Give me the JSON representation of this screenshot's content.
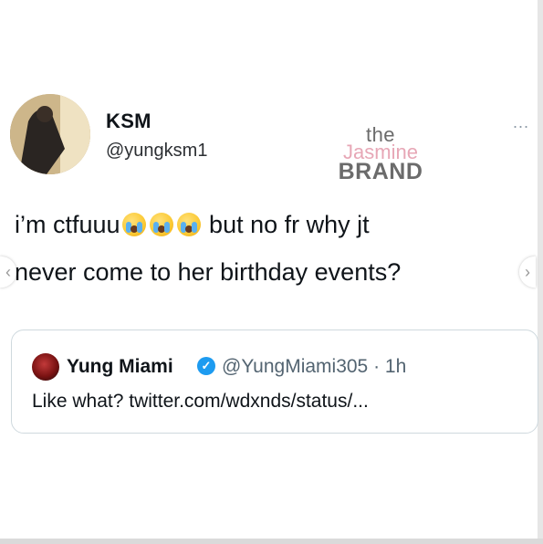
{
  "tweet": {
    "name": "KSM",
    "handle": "@yungksm1",
    "line1_before": "i’m ctfuuu",
    "line1_after": " but no fr why jt",
    "line2": "never come to her birthday events?",
    "emoji_count": 3,
    "emoji_icon": "loudly-crying-face-emoji",
    "more_label": "..."
  },
  "watermark": {
    "the": "the",
    "jasmine": "Jasmine",
    "brand": "BRAND"
  },
  "quote": {
    "name": "Yung Miami",
    "handle_time": "@YungMiami305 · 1h",
    "text": "Like what? twitter.com/wdxnds/status/...",
    "verified_icon": "verified-badge-icon",
    "verified_color": "#1d9bf0"
  },
  "nav": {
    "prev_glyph": "‹",
    "next_glyph": "›"
  }
}
